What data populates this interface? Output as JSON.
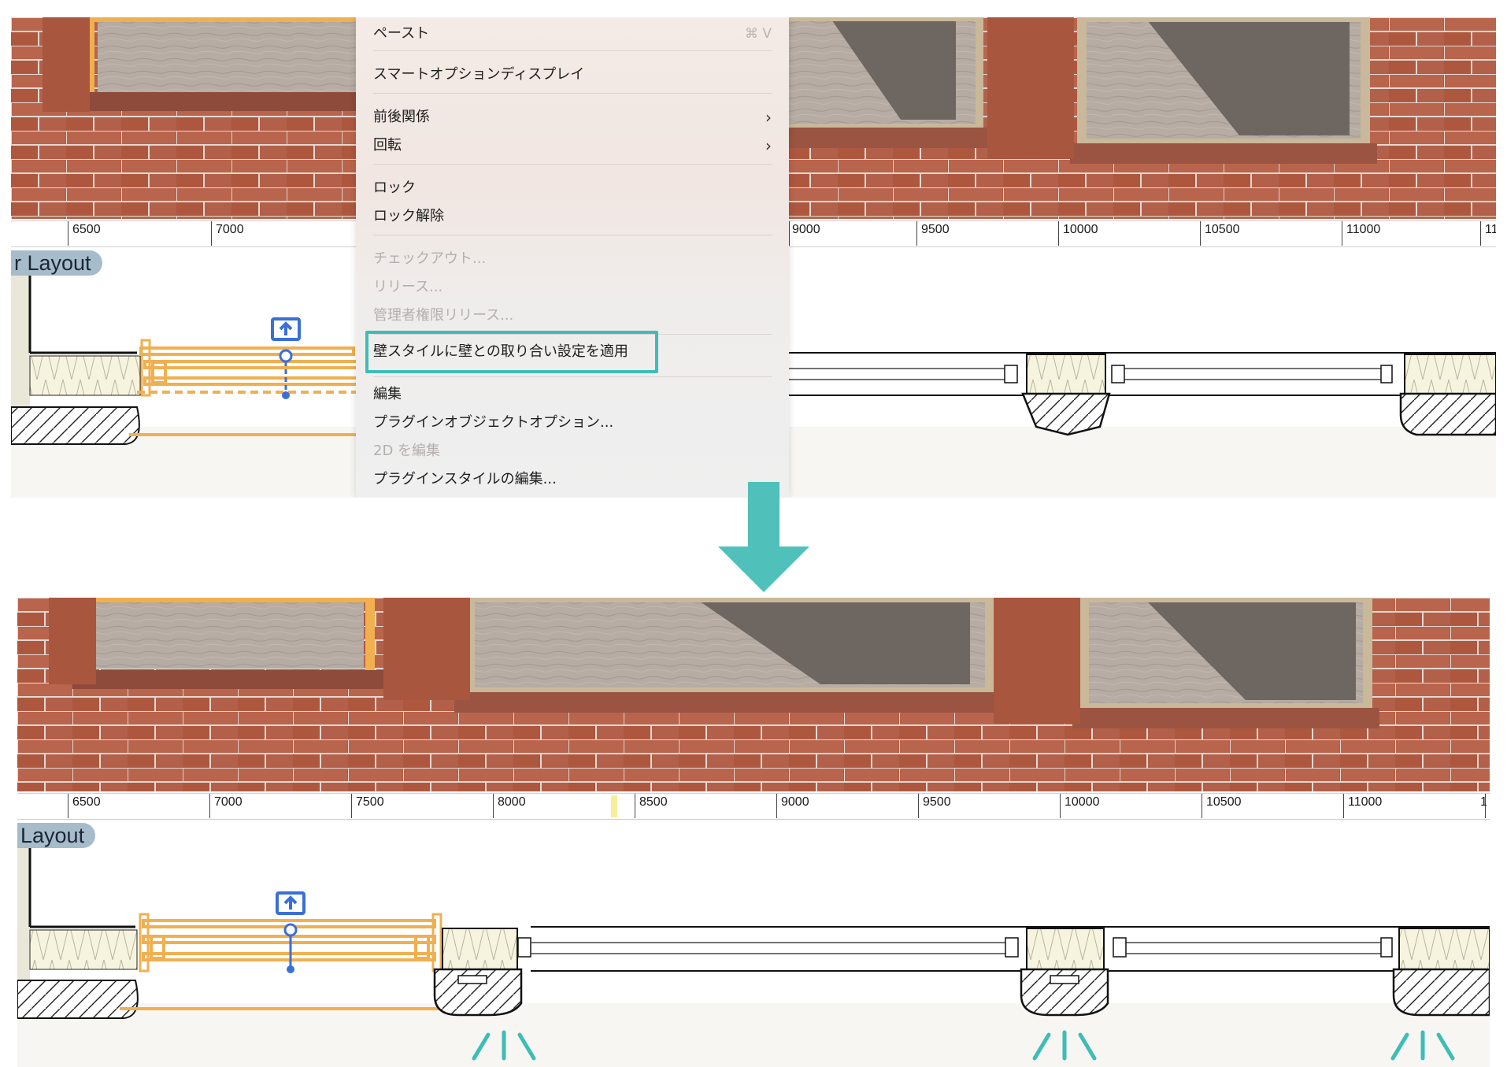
{
  "context_menu": {
    "items": [
      {
        "label": "ペースト",
        "shortcut": "⌘ V",
        "enabled": true,
        "submenu": false
      },
      {
        "label": "スマートオプションディスプレイ",
        "enabled": true,
        "submenu": false
      },
      {
        "label": "前後関係",
        "enabled": true,
        "submenu": true
      },
      {
        "label": "回転",
        "enabled": true,
        "submenu": true
      },
      {
        "label": "ロック",
        "enabled": true,
        "submenu": false
      },
      {
        "label": "ロック解除",
        "enabled": true,
        "submenu": false
      },
      {
        "label": "チェックアウト...",
        "enabled": false,
        "submenu": false
      },
      {
        "label": "リリース...",
        "enabled": false,
        "submenu": false
      },
      {
        "label": "管理者権限リリース...",
        "enabled": false,
        "submenu": false
      },
      {
        "label": "壁スタイルに壁との取り合い設定を適用",
        "enabled": true,
        "submenu": false,
        "highlighted": true
      },
      {
        "label": "編集",
        "enabled": true,
        "submenu": false
      },
      {
        "label": "プラグインオブジェクトオプション...",
        "enabled": true,
        "submenu": false
      },
      {
        "label": "2D を編集",
        "enabled": false,
        "submenu": false
      },
      {
        "label": "プラグインスタイルの編集...",
        "enabled": true,
        "submenu": false
      }
    ],
    "chevron": "›"
  },
  "top_panel": {
    "layer_tag": "r Layout",
    "ruler_labels": [
      "6500",
      "7000",
      "9000",
      "9500",
      "10000",
      "10500",
      "11000",
      "11"
    ]
  },
  "bottom_panel": {
    "layer_tag": "Layout",
    "ruler_labels": [
      "6500",
      "7000",
      "7500",
      "8000",
      "8500",
      "9000",
      "9500",
      "10000",
      "10500",
      "11000",
      "1"
    ]
  },
  "colors": {
    "accent_teal": "#3dbdb6",
    "selection_orange": "#f0b050",
    "brick": "#b35c45",
    "handle_blue": "#3b6fd8",
    "layer_tag_bg": "#a6bccb"
  },
  "icons": {
    "arrow": "down-arrow-icon",
    "move_handle": "upload-arrow-icon",
    "sparkle": "emphasis-marks-icon"
  }
}
